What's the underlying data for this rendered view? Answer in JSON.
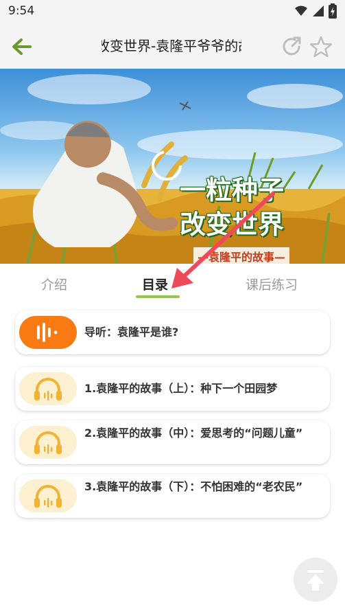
{
  "status_bar": {
    "time": "9:54"
  },
  "header": {
    "title": "改变世界-袁隆平爷爷的故事"
  },
  "banner": {
    "title_line1": "一粒种子",
    "title_line2": "改变世界",
    "subtitle": "—袁隆平的故事—"
  },
  "tabs": [
    {
      "label": "介绍"
    },
    {
      "label": "目录"
    },
    {
      "label": "课后练习"
    }
  ],
  "catalog": [
    {
      "label": "导听：袁隆平是谁?"
    },
    {
      "label": "1.袁隆平的故事（上）：种下一个田园梦"
    },
    {
      "label": "2.袁隆平的故事（中）：爱思考的“问题儿童”"
    },
    {
      "label": "3.袁隆平的故事（下）：不怕困难的“老农民”"
    }
  ],
  "colors": {
    "accent_green": "#93c94a",
    "back_arrow": "#6a9a2e",
    "active_pill": "#f97a12",
    "inactive_pill": "#fdf0d0",
    "headphone": "#f2b233",
    "annotation_arrow": "#ef4a5c"
  }
}
